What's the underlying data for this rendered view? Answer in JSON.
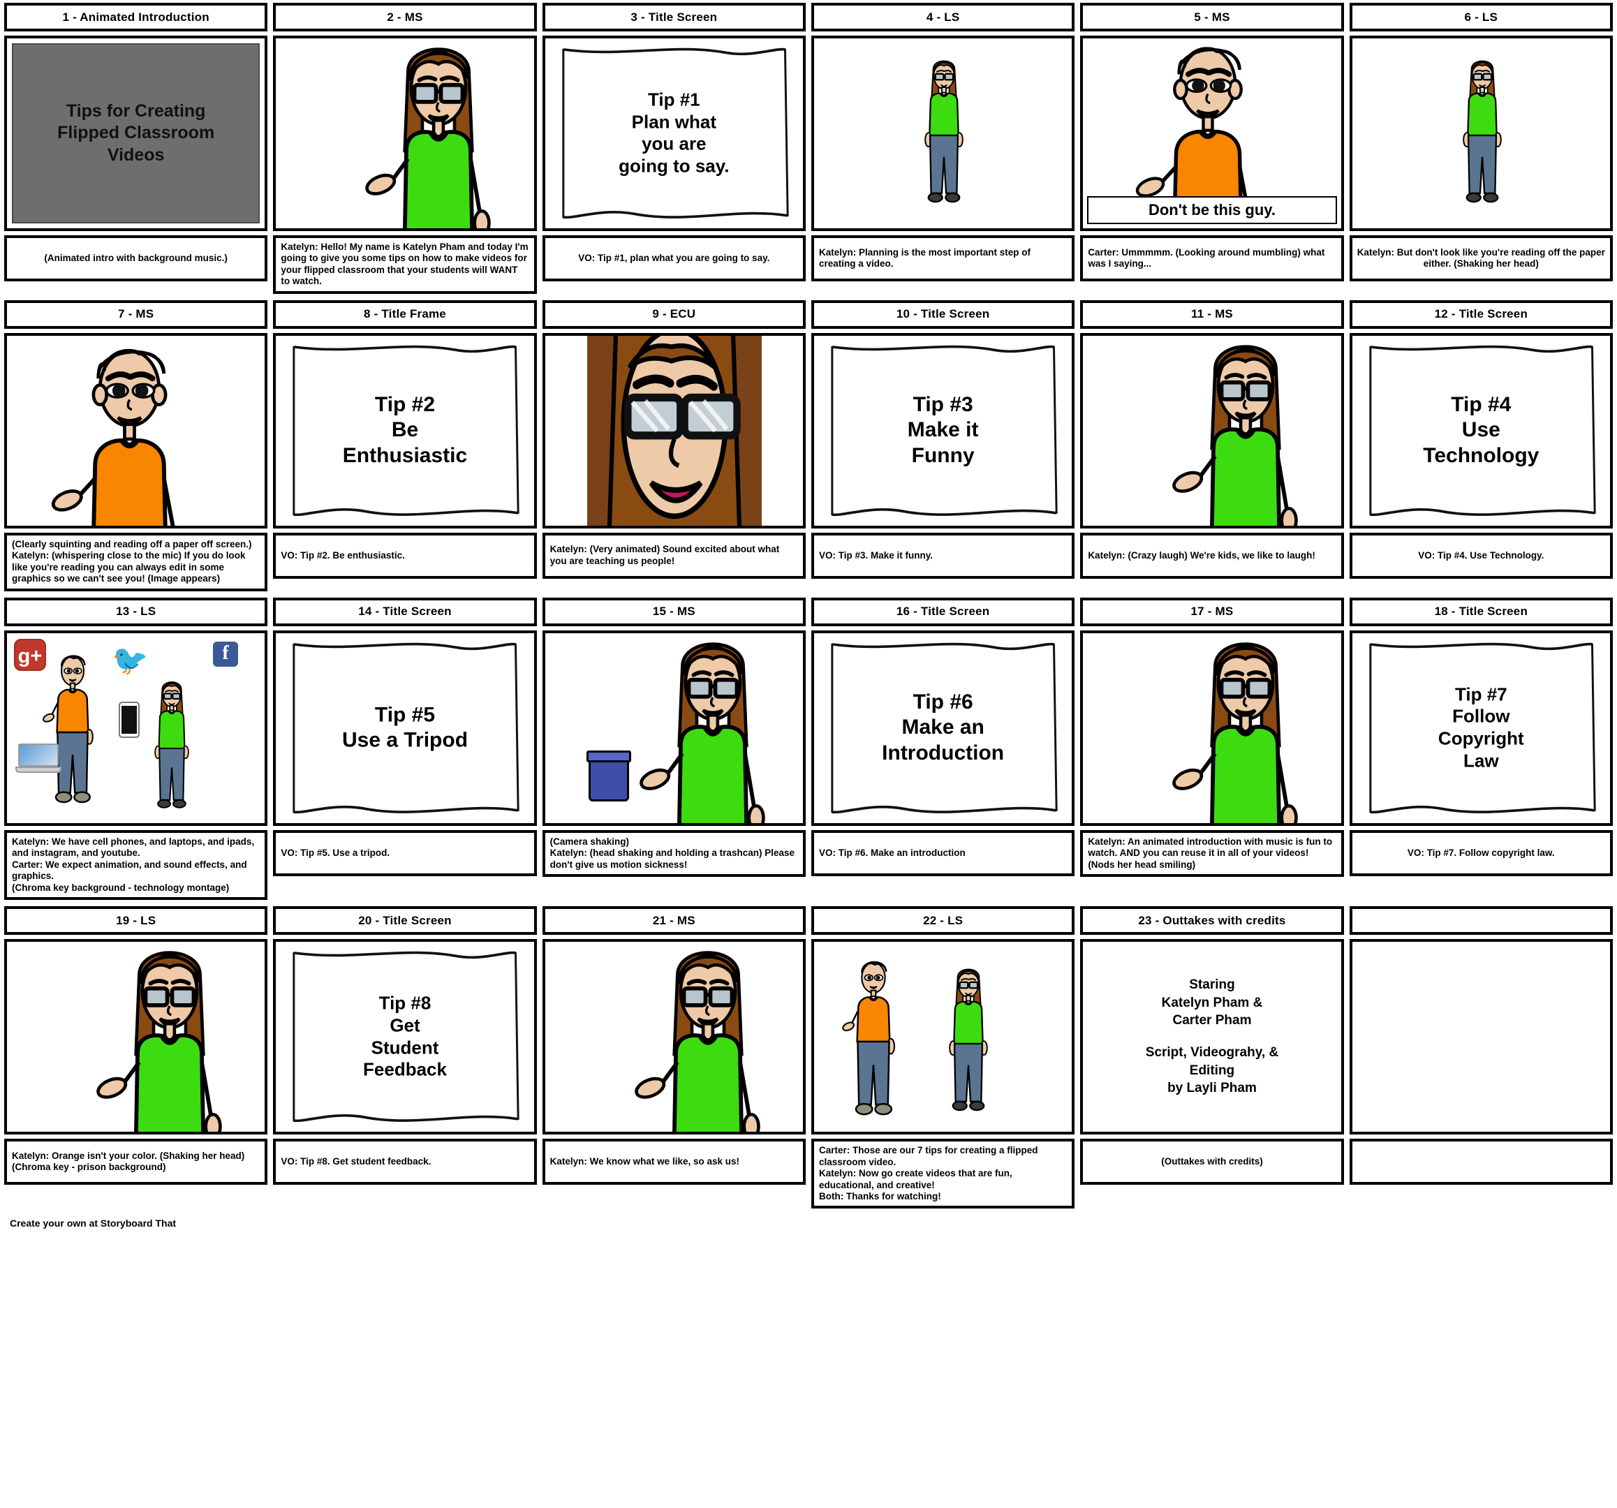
{
  "footer": {
    "text": "Create your own at Storyboard That"
  },
  "title_slide": {
    "lines": [
      "Tips for Creating",
      "Flipped Classroom",
      "Videos"
    ]
  },
  "banner": {
    "dont_be_this_guy": "Don't be this guy."
  },
  "credits": {
    "block1": [
      "Staring",
      "Katelyn Pham &",
      "Carter Pham"
    ],
    "block2": [
      "Script, Videograhy, &",
      "Editing",
      "by Layli Pham"
    ]
  },
  "cells": [
    {
      "title": "1 - Animated Introduction",
      "art": "title-slide",
      "caption_align": "center",
      "caption": [
        "(Animated intro with background music.)"
      ]
    },
    {
      "title": "2 - MS",
      "art": "girl-ms-green",
      "caption_align": "left",
      "caption": [
        "Katelyn: Hello! My name is Katelyn Pham and today I'm going to give you some tips on how to make videos for your flipped classroom that your students will WANT to watch."
      ]
    },
    {
      "title": "3 - Title Screen",
      "art": "paper",
      "paper_lines": [
        "Tip #1",
        "Plan what",
        "you are",
        "going to say."
      ],
      "paper_size": "small",
      "caption_align": "center",
      "caption": [
        "VO: Tip #1, plan what you are going to say."
      ]
    },
    {
      "title": "4 - LS",
      "art": "girl-ls-green",
      "caption_align": "left",
      "caption": [
        "Katelyn: Planning is the most important step of creating a video."
      ]
    },
    {
      "title": "5 - MS",
      "art": "boy-ms-orange-banner",
      "caption_align": "left",
      "caption": [
        "Carter: Ummmmm. (Looking around mumbling) what was I saying..."
      ]
    },
    {
      "title": "6 - LS",
      "art": "girl-ls-green",
      "caption_align": "center",
      "caption": [
        "Katelyn: But don't look like you're reading off the paper either. (Shaking her head)"
      ]
    },
    {
      "title": "7 - MS",
      "art": "boy-ms-orange",
      "caption_align": "left",
      "caption": [
        "(Clearly squinting and reading off a paper off screen.)",
        "Katelyn: (whispering close to the mic) If you do look like you're reading you can always edit in some graphics so we can't see you! (Image appears)"
      ]
    },
    {
      "title": "8 - Title Frame",
      "art": "paper",
      "paper_lines": [
        "Tip #2",
        "Be",
        "Enthusiastic"
      ],
      "paper_size": "normal",
      "caption_align": "left",
      "caption": [
        "VO: Tip #2. Be enthusiastic."
      ]
    },
    {
      "title": "9 - ECU",
      "art": "girl-ecu",
      "caption_align": "left",
      "caption": [
        "Katelyn: (Very animated) Sound excited about what you are teaching us people!"
      ]
    },
    {
      "title": "10 - Title Screen",
      "art": "paper",
      "paper_lines": [
        "Tip #3",
        "Make it",
        "Funny"
      ],
      "paper_size": "normal",
      "caption_align": "left",
      "caption": [
        "VO: Tip #3. Make it funny."
      ]
    },
    {
      "title": "11 - MS",
      "art": "girl-ms-green",
      "caption_align": "left",
      "caption": [
        "Katelyn: (Crazy laugh) We're kids, we like to laugh!"
      ]
    },
    {
      "title": "12 - Title Screen",
      "art": "paper",
      "paper_lines": [
        "Tip #4",
        "Use",
        "Technology"
      ],
      "paper_size": "normal",
      "caption_align": "center",
      "caption": [
        "VO: Tip #4. Use Technology."
      ]
    },
    {
      "title": "13 - LS",
      "art": "tech-montage",
      "caption_align": "left",
      "caption": [
        "Katelyn: We have cell phones, and laptops, and ipads, and instagram, and youtube.",
        "Carter: We expect animation, and sound effects, and graphics.",
        "(Chroma key background - technology montage)"
      ]
    },
    {
      "title": "14 - Title Screen",
      "art": "paper",
      "paper_lines": [
        "Tip #5",
        "Use a Tripod"
      ],
      "paper_size": "normal",
      "caption_align": "left",
      "caption": [
        "VO: Tip #5. Use a tripod."
      ]
    },
    {
      "title": "15 - MS",
      "art": "girl-ms-trashcan",
      "caption_align": "left",
      "caption": [
        "(Camera shaking)",
        "Katelyn: (head shaking and holding a trashcan) Please don't give us motion sickness!"
      ]
    },
    {
      "title": "16 - Title Screen",
      "art": "paper",
      "paper_lines": [
        "Tip #6",
        "Make an",
        "Introduction"
      ],
      "paper_size": "normal",
      "caption_align": "left",
      "caption": [
        "VO: Tip #6. Make an introduction"
      ]
    },
    {
      "title": "17 - MS",
      "art": "girl-ms-green",
      "caption_align": "left",
      "caption": [
        "Katelyn: An animated introduction with music is fun to watch. AND you can reuse it in all of your videos! (Nods her head smiling)"
      ]
    },
    {
      "title": "18 - Title Screen",
      "art": "paper",
      "paper_lines": [
        "Tip #7",
        "Follow",
        "Copyright",
        "Law"
      ],
      "paper_size": "small",
      "caption_align": "center",
      "caption": [
        "VO: Tip #7. Follow copyright law."
      ]
    },
    {
      "title": "19 - LS",
      "art": "girl-ms-green-small",
      "caption_align": "left",
      "caption": [
        "Katelyn: Orange isn't your color. (Shaking her head)",
        "(Chroma key - prison background)"
      ]
    },
    {
      "title": "20 - Title Screen",
      "art": "paper",
      "paper_lines": [
        "Tip #8",
        "Get",
        "Student",
        "Feedback"
      ],
      "paper_size": "small",
      "caption_align": "left",
      "caption": [
        "VO: Tip #8. Get student feedback."
      ]
    },
    {
      "title": "21 - MS",
      "art": "girl-ms-green",
      "caption_align": "left",
      "caption": [
        "Katelyn: We know what we like, so ask us!"
      ]
    },
    {
      "title": "22 - LS",
      "art": "two-characters-ls",
      "caption_align": "left",
      "caption": [
        "Carter: Those are our 7 tips for creating a flipped classroom video.",
        "Katelyn: Now go create videos that are fun, educational, and creative!",
        "Both: Thanks for watching!"
      ]
    },
    {
      "title": "23 - Outtakes with credits",
      "art": "credits",
      "caption_align": "center",
      "caption": [
        "(Outtakes with credits)"
      ]
    },
    {
      "title": "",
      "art": "blank",
      "caption_align": "center",
      "caption": [
        ""
      ]
    }
  ],
  "colors": {
    "shirt_green": "#3ddc11",
    "shirt_orange": "#f98600",
    "jeans": "#5b7491",
    "hair_brown": "#8a4b13",
    "skin": "#eecaa8",
    "grey_slide": "#6e6e6e",
    "gplus_red": "#c0392b",
    "facebook_blue": "#3b5998",
    "twitter_blue": "#35aae0",
    "trash_blue": "#3f4fa8"
  }
}
